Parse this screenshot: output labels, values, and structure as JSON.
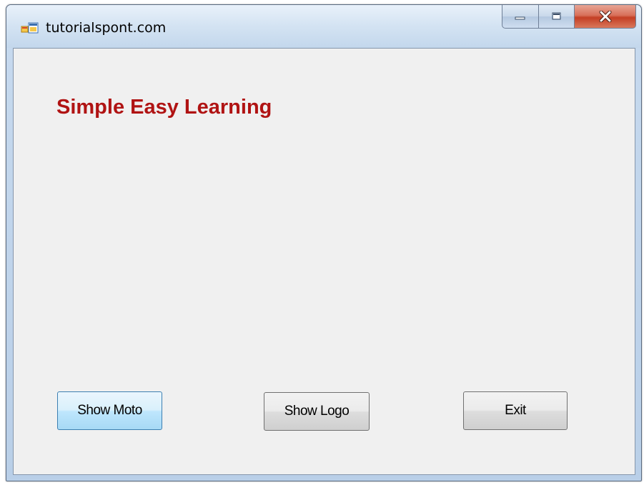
{
  "window": {
    "title": "tutorialspont.com"
  },
  "titlebar": {
    "app_icon": "windows-form-icon",
    "minimize_icon": "minimize-icon",
    "maximize_icon": "maximize-icon",
    "close_icon": "close-icon"
  },
  "content": {
    "heading": "Simple Easy Learning",
    "heading_color": "#b01313"
  },
  "buttons": {
    "show_moto": "Show Moto",
    "show_logo": "Show Logo",
    "exit": "Exit"
  }
}
